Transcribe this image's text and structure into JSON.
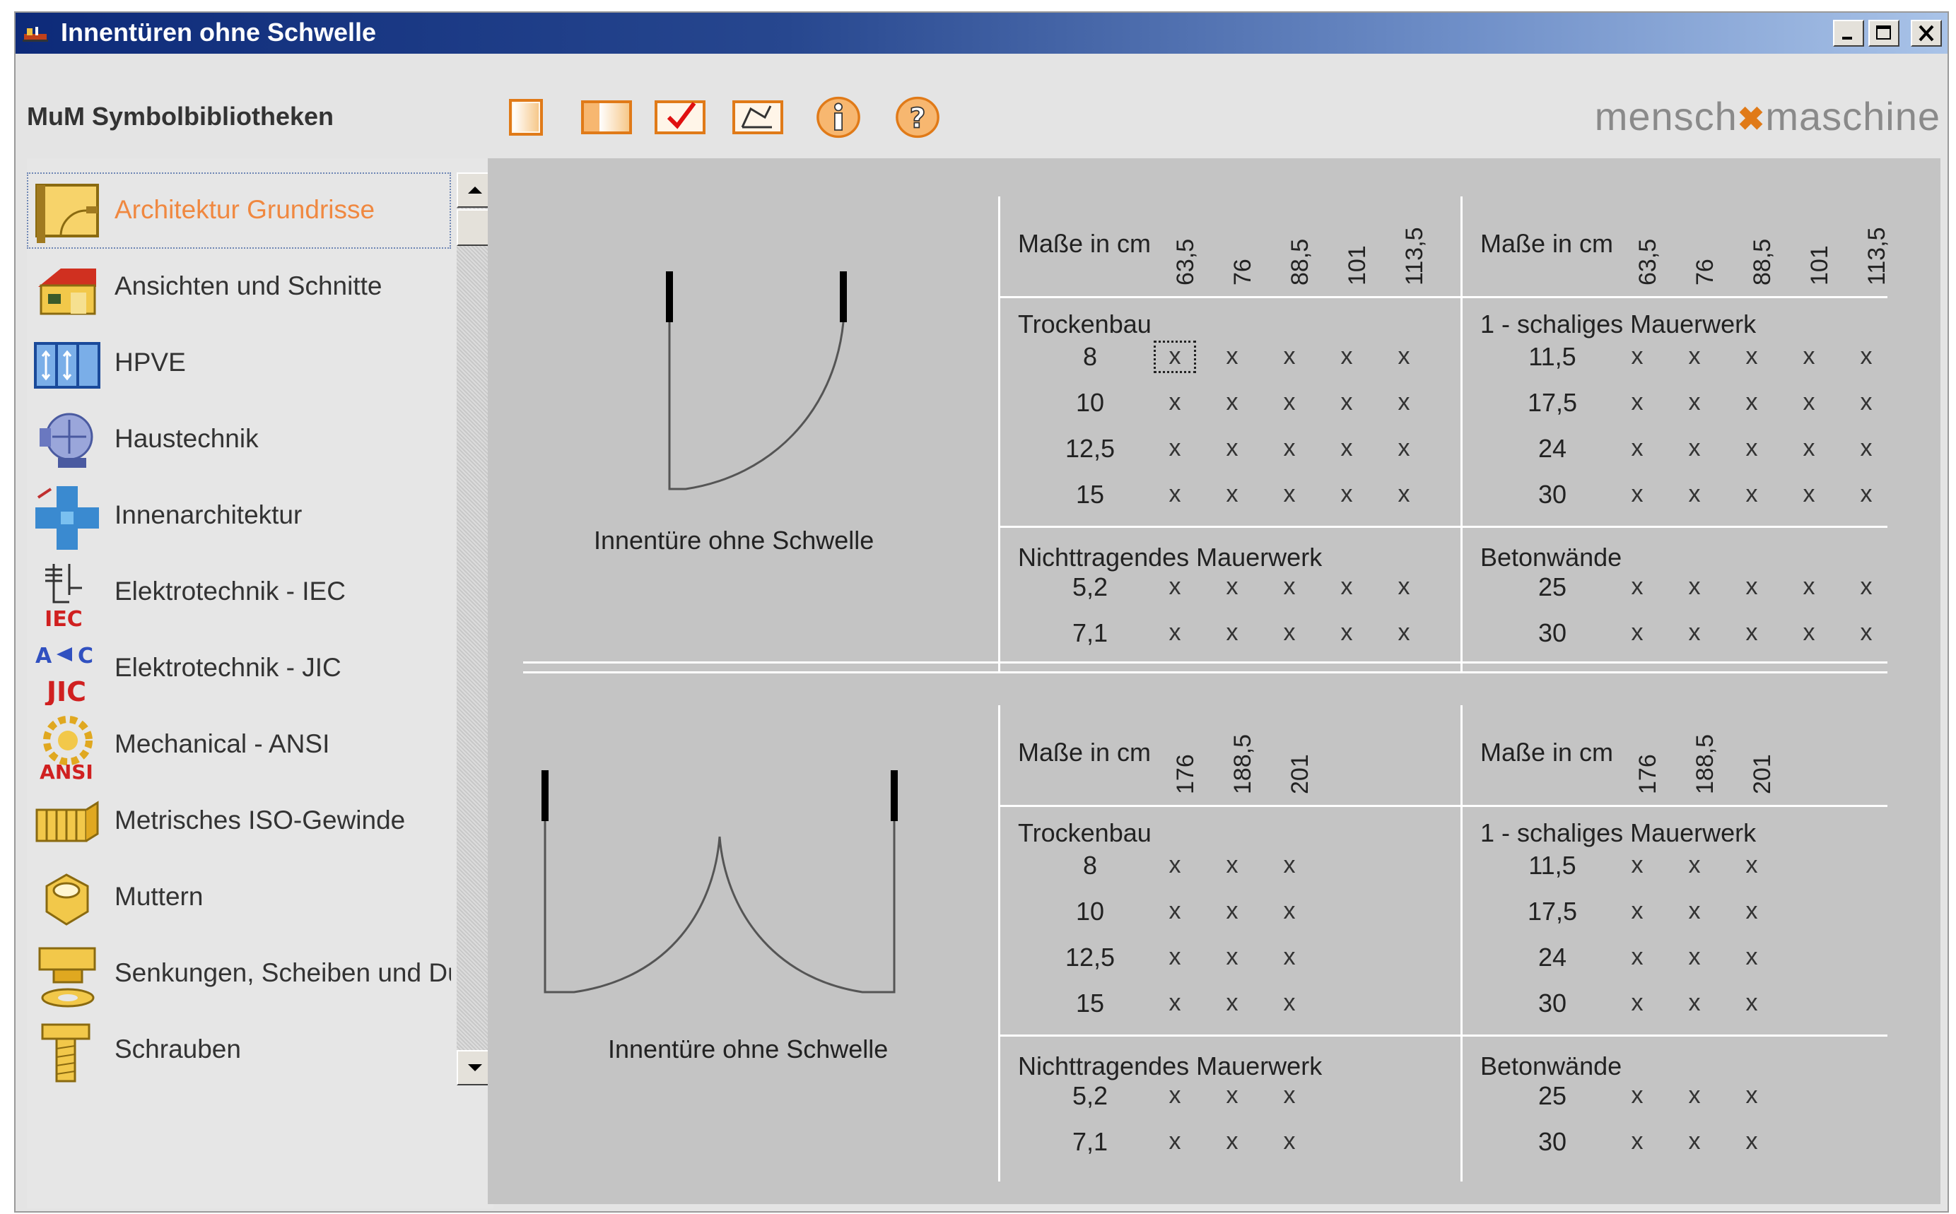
{
  "window": {
    "title": "Innentüren ohne Schwelle",
    "controls": [
      "minimize",
      "maximize",
      "close"
    ]
  },
  "toolbar": {
    "library_title": "MuM Symbolbibliotheken",
    "buttons": [
      {
        "icon": "blank-page-icon"
      },
      {
        "icon": "open-panel-icon"
      },
      {
        "icon": "checkmark-icon"
      },
      {
        "icon": "insert-symbol-icon"
      },
      {
        "icon": "info-icon"
      },
      {
        "icon": "help-icon"
      }
    ],
    "brand_left": "mensch",
    "brand_sep": "✖",
    "brand_right": "maschine",
    "accent_color": "#e07a18"
  },
  "sidebar": {
    "items": [
      {
        "label": "Architektur Grundrisse",
        "icon": "floorplan-icon",
        "selected": true
      },
      {
        "label": "Ansichten und Schnitte",
        "icon": "house-icon"
      },
      {
        "label": "HPVE",
        "icon": "hpve-icon"
      },
      {
        "label": "Haustechnik",
        "icon": "hvac-icon"
      },
      {
        "label": "Innenarchitektur",
        "icon": "interior-icon"
      },
      {
        "label": "Elektrotechnik - IEC",
        "icon": "iec-icon",
        "badge": "IEC"
      },
      {
        "label": "Elektrotechnik - JIC",
        "icon": "jic-icon",
        "badge": "JIC"
      },
      {
        "label": "Mechanical - ANSI",
        "icon": "gear-ansi-icon",
        "badge": "ANSI"
      },
      {
        "label": "Metrisches ISO-Gewinde",
        "icon": "thread-icon"
      },
      {
        "label": "Muttern",
        "icon": "nut-icon"
      },
      {
        "label": "Senkungen, Scheiben und Du",
        "icon": "washer-icon"
      },
      {
        "label": "Schrauben",
        "icon": "screw-icon"
      }
    ]
  },
  "panels": [
    {
      "door_label": "Innentüre ohne Schwelle",
      "door_type": "single",
      "left": {
        "header": "Maße in cm",
        "columns": [
          "63,5",
          "76",
          "88,5",
          "101",
          "113,5"
        ],
        "sections": [
          {
            "title": "Trockenbau",
            "rows": [
              "8",
              "10",
              "12,5",
              "15"
            ]
          },
          {
            "title": "Nichttragendes Mauerwerk",
            "rows": [
              "5,2",
              "7,1"
            ]
          }
        ]
      },
      "right": {
        "header": "Maße in cm",
        "columns": [
          "63,5",
          "76",
          "88,5",
          "101",
          "113,5"
        ],
        "sections": [
          {
            "title": "1 - schaliges Mauerwerk",
            "rows": [
              "11,5",
              "17,5",
              "24",
              "30"
            ]
          },
          {
            "title": "Betonwände",
            "rows": [
              "25",
              "30"
            ]
          }
        ]
      },
      "cell_mark": "x"
    },
    {
      "door_label": "Innentüre ohne Schwelle",
      "door_type": "double",
      "left": {
        "header": "Maße in cm",
        "columns": [
          "176",
          "188,5",
          "201"
        ],
        "sections": [
          {
            "title": "Trockenbau",
            "rows": [
              "8",
              "10",
              "12,5",
              "15"
            ]
          },
          {
            "title": "Nichttragendes Mauerwerk",
            "rows": [
              "5,2",
              "7,1"
            ]
          }
        ]
      },
      "right": {
        "header": "Maße in cm",
        "columns": [
          "176",
          "188,5",
          "201"
        ],
        "sections": [
          {
            "title": "1 - schaliges Mauerwerk",
            "rows": [
              "11,5",
              "17,5",
              "24",
              "30"
            ]
          },
          {
            "title": "Betonwände",
            "rows": [
              "25",
              "30"
            ]
          }
        ]
      },
      "cell_mark": "x"
    }
  ]
}
